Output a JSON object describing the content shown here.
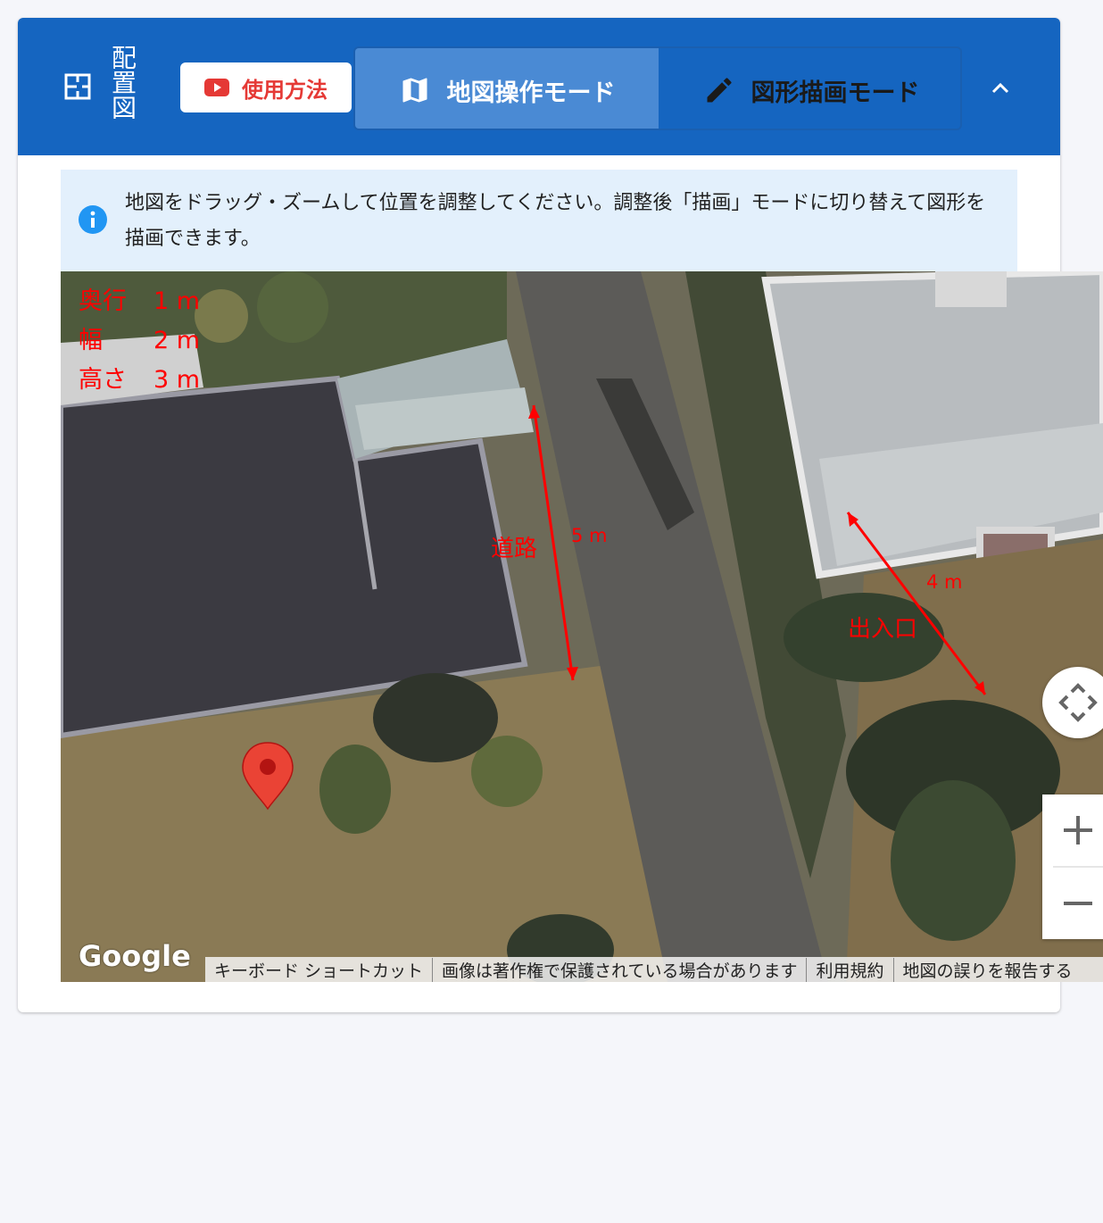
{
  "header": {
    "title": "配置図",
    "howto_label": "使用方法",
    "tabs": [
      {
        "label": "地図操作モード",
        "active": true
      },
      {
        "label": "図形描画モード",
        "active": false
      }
    ]
  },
  "info": {
    "text": "地図をドラッグ・ズームして位置を調整してください。調整後「描画」モードに切り替えて図形を描画できます。"
  },
  "map": {
    "dimensions": [
      {
        "label": "奥行",
        "value": "1 m"
      },
      {
        "label": "幅",
        "value": "2 m"
      },
      {
        "label": "高さ",
        "value": "3 m"
      }
    ],
    "annotations": {
      "road_label": "道路",
      "road_length": "5 m",
      "entrance_label": "出入口",
      "entrance_length": "4 m"
    },
    "google_logo": "Google",
    "attribution": [
      "キーボード ショートカット",
      "画像は著作権で保護されている場合があります",
      "利用規約",
      "地図の誤りを報告する"
    ]
  },
  "colors": {
    "header": "#1565c0",
    "active_tab": "#4a8ad4",
    "info_bg": "#e3f0fc",
    "annotation": "#ff0000"
  }
}
